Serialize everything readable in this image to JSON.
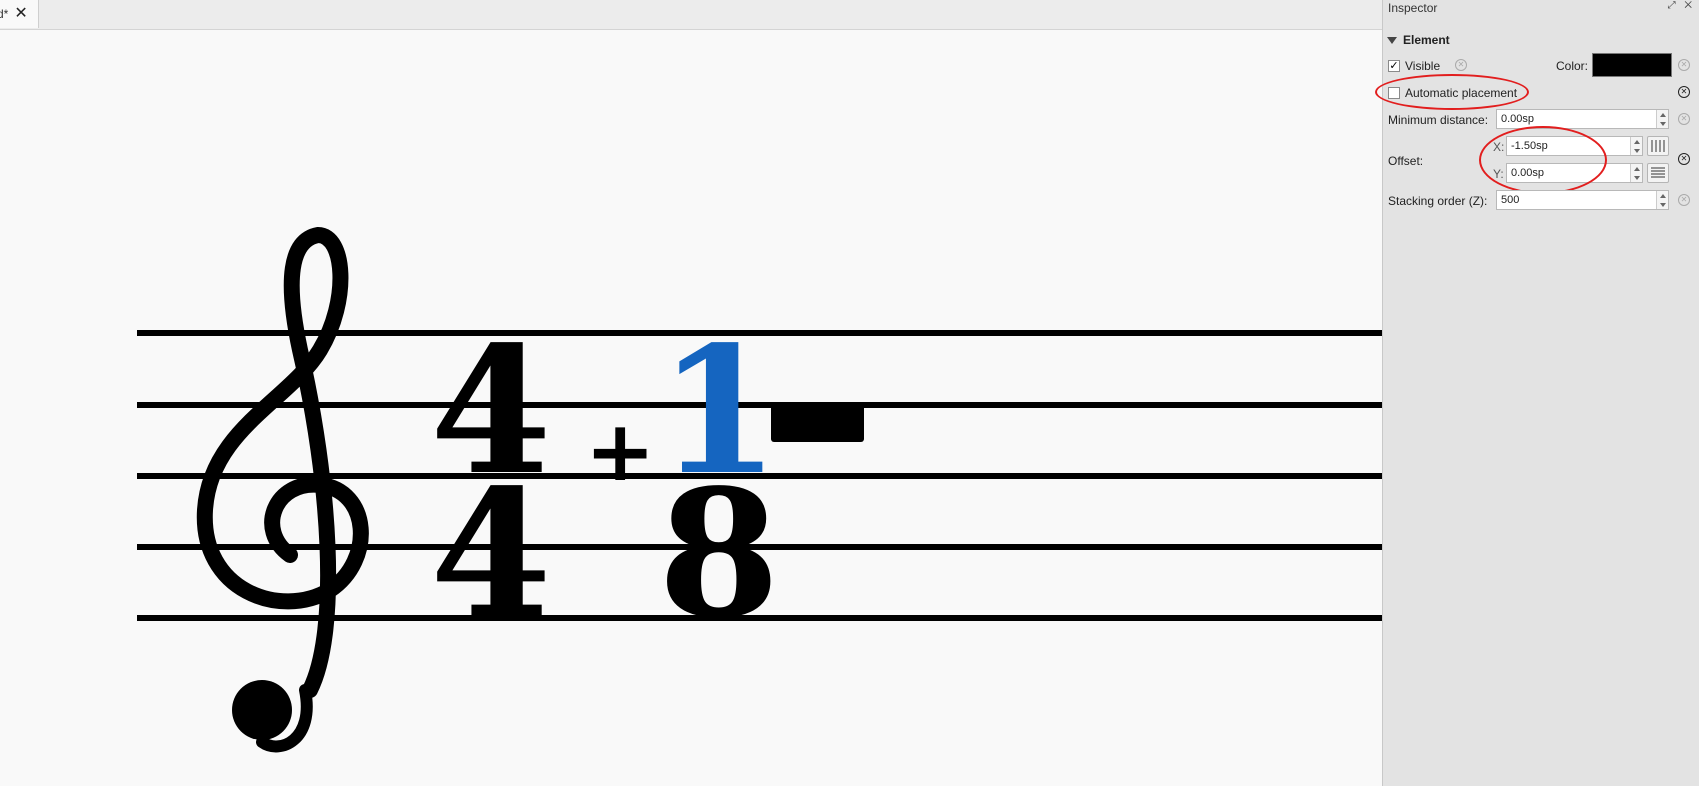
{
  "tab": {
    "label": "d*",
    "close": "✕"
  },
  "inspector": {
    "title": "Inspector",
    "window_buttons": "⤢ ✕",
    "section": "Element",
    "visible_label": "Visible",
    "visible_checked": true,
    "color_label": "Color:",
    "color_value": "#000000",
    "auto_placement_label": "Automatic placement",
    "auto_placement_checked": false,
    "min_distance_label": "Minimum distance:",
    "min_distance_value": "0.00sp",
    "offset_label": "Offset:",
    "offset_x_label": "X:",
    "offset_x_value": "-1.50sp",
    "offset_y_label": "Y:",
    "offset_y_value": "0.00sp",
    "stacking_label": "Stacking order (Z):",
    "stacking_value": "500",
    "reset_glyph": "✕"
  },
  "score": {
    "time_sig": {
      "top_left": "4",
      "bottom_left": "4",
      "plus": "+",
      "top_right": "1",
      "bottom_right": "8"
    },
    "highlight_color": "#1565c0"
  }
}
